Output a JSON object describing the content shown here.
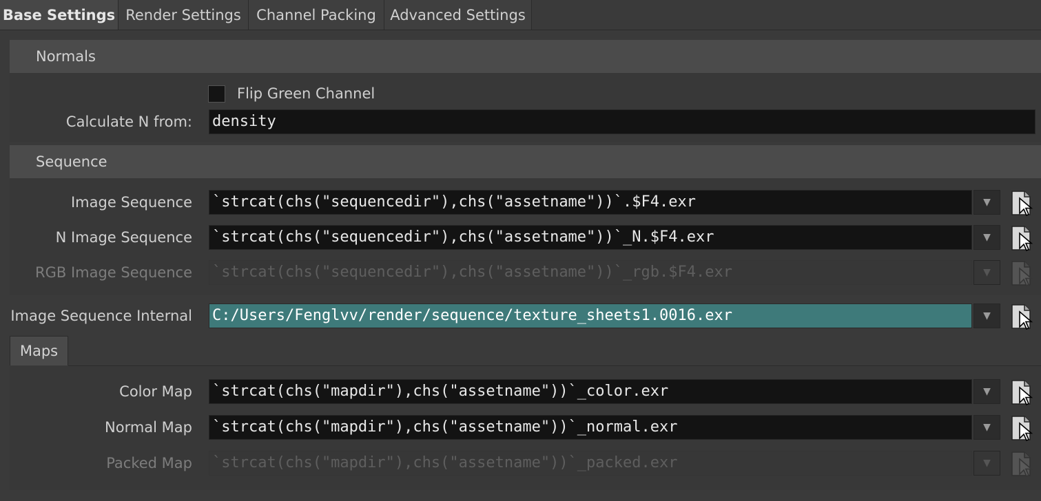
{
  "tabs": [
    {
      "label": "Base Settings",
      "active": true
    },
    {
      "label": "Render Settings",
      "active": false
    },
    {
      "label": "Channel Packing",
      "active": false
    },
    {
      "label": "Advanced Settings",
      "active": false
    }
  ],
  "normals": {
    "header": "Normals",
    "flip_green_label": "Flip Green Channel",
    "flip_green_checked": false,
    "calc_n_label": "Calculate N from:",
    "calc_n_value": "density"
  },
  "sequence": {
    "header": "Sequence",
    "image_sequence": {
      "label": "Image Sequence",
      "value": "`strcat(chs(\"sequencedir\"),chs(\"assetname\"))`.$F4.exr"
    },
    "n_image_sequence": {
      "label": "N Image Sequence",
      "value": "`strcat(chs(\"sequencedir\"),chs(\"assetname\"))`_N.$F4.exr"
    },
    "rgb_image_sequence": {
      "label": "RGB Image Sequence",
      "value": "`strcat(chs(\"sequencedir\"),chs(\"assetname\"))`_rgb.$F4.exr"
    },
    "image_sequence_internal": {
      "label": "Image Sequence Internal",
      "value": "C:/Users/Fenglvv/render/sequence/texture_sheets1.0016.exr"
    }
  },
  "maps": {
    "tab_label": "Maps",
    "color_map": {
      "label": "Color Map",
      "value": "`strcat(chs(\"mapdir\"),chs(\"assetname\"))`_color.exr"
    },
    "normal_map": {
      "label": "Normal Map",
      "value": "`strcat(chs(\"mapdir\"),chs(\"assetname\"))`_normal.exr"
    },
    "packed_map": {
      "label": "Packed Map",
      "value": "`strcat(chs(\"mapdir\"),chs(\"assetname\"))`_packed.exr"
    }
  },
  "icons": {
    "dropdown": "chevron-down-icon",
    "file_chooser": "file-chooser-icon"
  },
  "colors": {
    "highlight_field": "#3e7a7a",
    "field_bg": "#131313",
    "panel_bg": "#3a3a3a"
  }
}
